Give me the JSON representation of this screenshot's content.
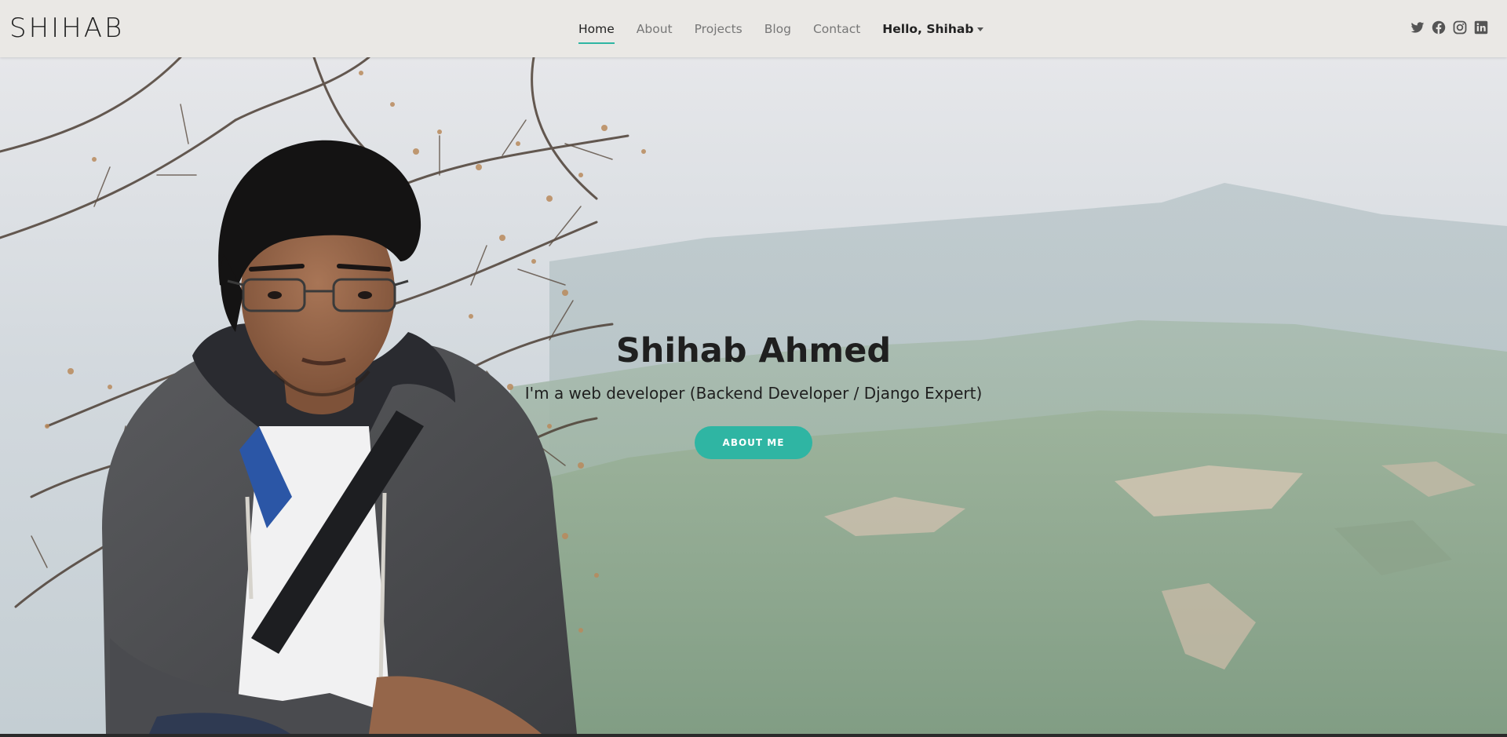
{
  "navbar": {
    "brand": "SHIHAB",
    "links": [
      {
        "label": "Home",
        "active": true
      },
      {
        "label": "About",
        "active": false
      },
      {
        "label": "Projects",
        "active": false
      },
      {
        "label": "Blog",
        "active": false
      },
      {
        "label": "Contact",
        "active": false
      }
    ],
    "user_menu": "Hello, Shihab",
    "social_icons": [
      "twitter-icon",
      "facebook-icon",
      "instagram-icon",
      "linkedin-icon"
    ]
  },
  "hero": {
    "title": "Shihab Ahmed",
    "subtitle": "I'm a web developer (Backend Developer / Django Expert)",
    "button_label": "ABOUT ME"
  },
  "colors": {
    "accent": "#2fb5a3",
    "navbar_bg": "#eae8e5",
    "text_dark": "#1f1f1f",
    "nav_inactive": "#777777"
  }
}
